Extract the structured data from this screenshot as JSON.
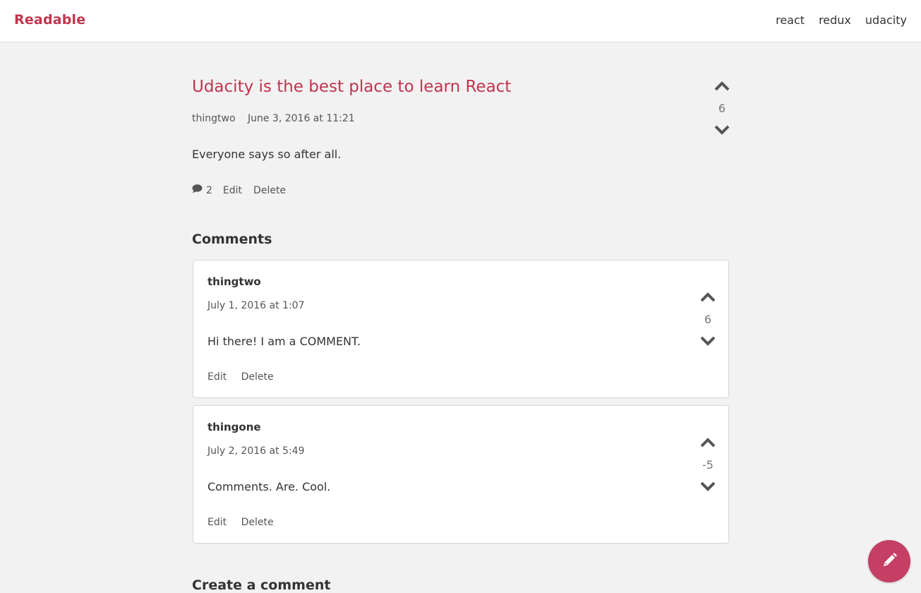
{
  "navbar": {
    "brand": "Readable",
    "links": [
      "react",
      "redux",
      "udacity"
    ]
  },
  "post": {
    "title": "Udacity is the best place to learn React",
    "author": "thingtwo",
    "date": "June 3, 2016 at 11:21",
    "body": "Everyone says so after all.",
    "comment_count": "2",
    "edit_label": "Edit",
    "delete_label": "Delete",
    "score": "6",
    "icons": {
      "upvote": "chevron-up-icon",
      "downvote": "chevron-down-icon",
      "comments": "comment-bubble-icon"
    }
  },
  "comments": {
    "heading": "Comments",
    "items": [
      {
        "author": "thingtwo",
        "date": "July 1, 2016 at 1:07",
        "body": "Hi there! I am a COMMENT.",
        "score": "6",
        "edit_label": "Edit",
        "delete_label": "Delete"
      },
      {
        "author": "thingone",
        "date": "July 2, 2016 at 5:49",
        "body": "Comments. Are. Cool.",
        "score": "-5",
        "edit_label": "Edit",
        "delete_label": "Delete"
      }
    ]
  },
  "create_comment": {
    "heading": "Create a comment"
  },
  "fab": {
    "icon": "pencil-icon"
  },
  "colors": {
    "brand": "#c0344d",
    "fab": "#c43f63",
    "background": "#f2f2f2",
    "muted": "#777777"
  }
}
